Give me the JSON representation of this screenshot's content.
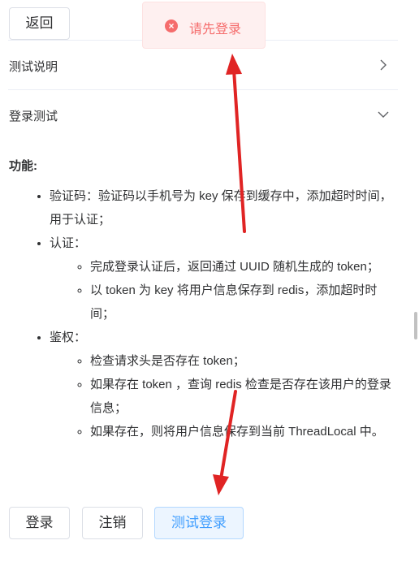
{
  "header": {
    "back_label": "返回"
  },
  "toast": {
    "message": "请先登录",
    "icon": "error-circle-icon",
    "color": "#f56c6c"
  },
  "collapse": [
    {
      "title": "测试说明",
      "state": "collapsed"
    },
    {
      "title": "登录测试",
      "state": "expanded"
    }
  ],
  "content": {
    "heading": "功能:",
    "items": [
      {
        "text": "验证码：验证码以手机号为 key 保存到缓存中，添加超时时间，用于认证；",
        "sub": []
      },
      {
        "text": "认证：",
        "sub": [
          "完成登录认证后，返回通过 UUID 随机生成的 token；",
          "以 token 为 key 将用户信息保存到 redis，添加超时时间；"
        ]
      },
      {
        "text": "鉴权：",
        "sub": [
          "检查请求头是否存在 token；",
          "如果存在 token ，查询 redis 检查是否存在该用户的登录信息；",
          "如果存在，则将用户信息保存到当前 ThreadLocal 中。"
        ]
      }
    ]
  },
  "buttons": {
    "login": "登录",
    "logout": "注销",
    "test_login": "测试登录"
  },
  "colors": {
    "primary": "#409eff",
    "arrow": "#e02424"
  }
}
